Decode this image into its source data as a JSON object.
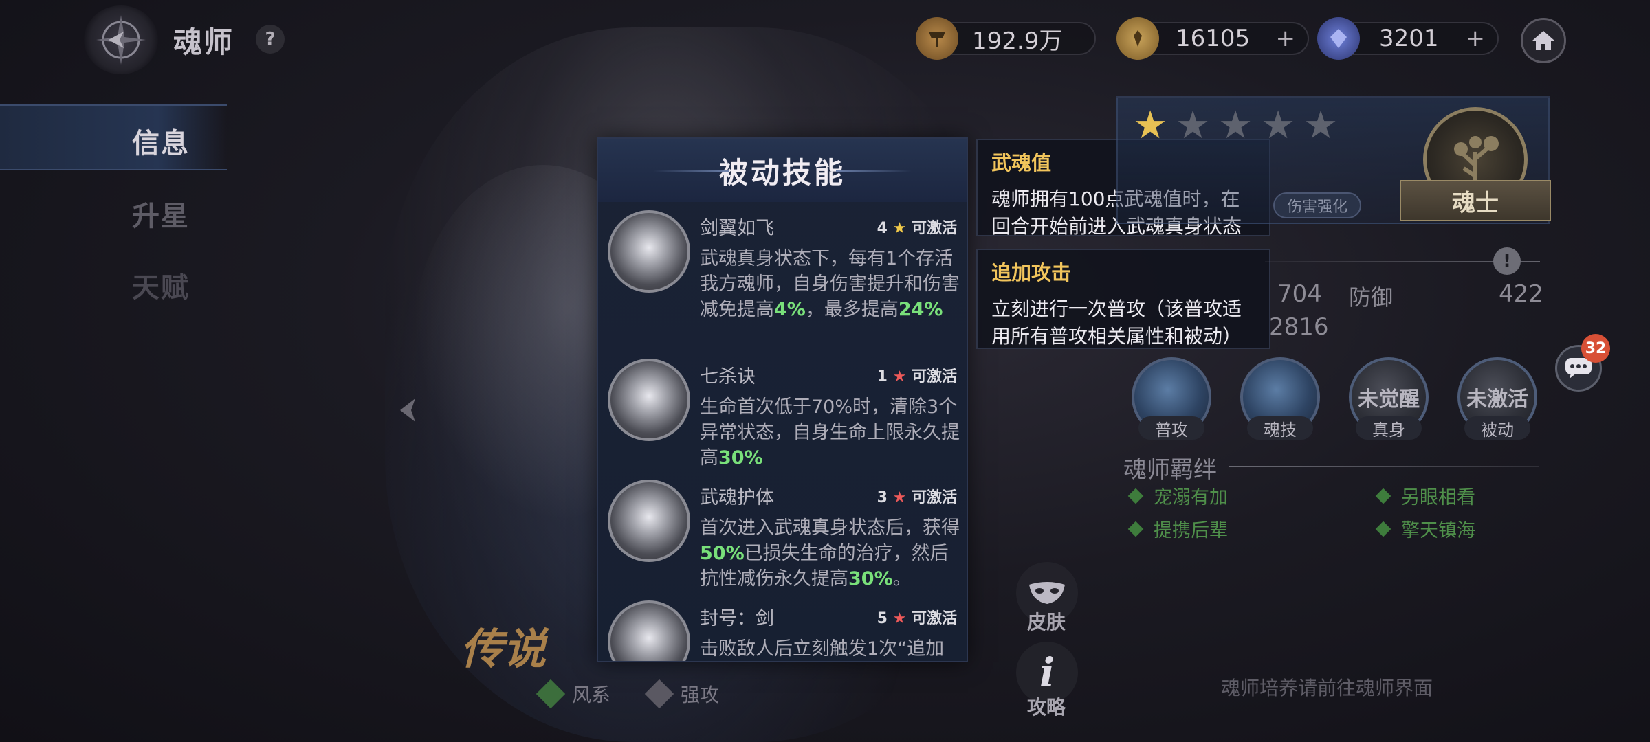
{
  "header": {
    "title": "魂师",
    "help": "?",
    "resources": [
      {
        "icon": "trophy-coin-icon",
        "value": "192.9万"
      },
      {
        "icon": "gold-coin-icon",
        "value": "16105"
      },
      {
        "icon": "crystal-gem-icon",
        "value": "3201"
      }
    ]
  },
  "tabs": [
    {
      "label": "信息",
      "active": true
    },
    {
      "label": "升星",
      "active": false
    },
    {
      "label": "天赋",
      "active": false
    }
  ],
  "passive_panel": {
    "title": "被动技能",
    "skills": [
      {
        "name": "剑翼如飞",
        "level": "4",
        "star": "★",
        "status": "可激活",
        "desc_parts": [
          "武魂真身状态下，每有1个存活我方魂师，自身伤害提升和伤害减免提高",
          "4%",
          "，最多提高",
          "24%"
        ]
      },
      {
        "name": "七杀诀",
        "level": "1",
        "star": "★",
        "status": "可激活",
        "desc_parts": [
          "生命首次低于70%时，清除3个异常状态，自身生命上限永久提高",
          "30%"
        ]
      },
      {
        "name": "武魂护体",
        "level": "3",
        "star": "★",
        "status": "可激活",
        "desc_parts": [
          "首次进入武魂真身状态后，获得",
          "50%",
          "已损失生命的治疗，然后抗性减伤永久提高",
          "30%",
          "。"
        ]
      },
      {
        "name": "封号：剑",
        "level": "5",
        "star": "★",
        "status": "可激活",
        "desc_parts": [
          "击败敌人后立刻触发1次“追加"
        ]
      }
    ]
  },
  "tooltips": [
    {
      "title": "武魂值",
      "text": "魂师拥有100点武魂值时，在回合开始前进入武魂真身状态"
    },
    {
      "title": "追加攻击",
      "text": "立刻进行一次普攻（该普攻适用所有普攻相关属性和被动）"
    }
  ],
  "hero_card": {
    "stars_filled": 1,
    "stars_total": 5,
    "damage_badge": "伤害强化",
    "rank": "魂士"
  },
  "stats": {
    "val_a": "704",
    "label_def": "防御",
    "val_def": "422",
    "val_b": "2816",
    "warn": "!"
  },
  "abilities": [
    {
      "caption": "普攻",
      "center": ""
    },
    {
      "caption": "魂技",
      "center": ""
    },
    {
      "caption": "真身",
      "center": "未觉醒"
    },
    {
      "caption": "被动",
      "center": "未激活"
    }
  ],
  "bonds": {
    "title": "魂师羁绊",
    "items": [
      "宠溺有加",
      "另眼相看",
      "提携后辈",
      "擎天镇海"
    ]
  },
  "chat": {
    "badge": "32"
  },
  "side_buttons": {
    "skin": "皮肤",
    "guide": "攻略"
  },
  "legend_badge": "传说",
  "elements": [
    "风系",
    "强攻"
  ],
  "footer_hint": "魂师培养请前往魂师界面",
  "colors": {
    "highlight": "#79e07a",
    "tooltip_title": "#f2c55c",
    "star_gold": "#e7c154",
    "bond_green": "#4f8f4a"
  }
}
